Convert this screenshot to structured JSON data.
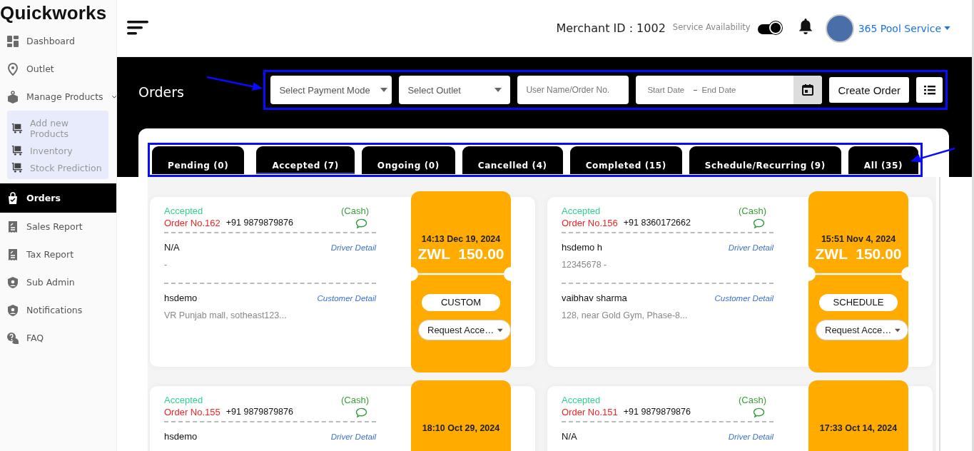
{
  "sidebar": {
    "logo": "Quickworks",
    "items": [
      {
        "label": "Dashboard",
        "selected": false
      },
      {
        "label": "Outlet",
        "selected": false
      },
      {
        "label": "Manage Products",
        "selected": false,
        "expanded": true,
        "children": [
          {
            "label": "Add new Products"
          },
          {
            "label": "Inventory"
          },
          {
            "label": "Stock Prediction"
          }
        ]
      },
      {
        "label": "Orders",
        "selected": true
      },
      {
        "label": "Sales Report",
        "selected": false
      },
      {
        "label": "Tax Report",
        "selected": false
      },
      {
        "label": "Sub Admin",
        "selected": false
      },
      {
        "label": "Notifications",
        "selected": false
      },
      {
        "label": "FAQ",
        "selected": false
      }
    ]
  },
  "header": {
    "merchant": "Merchant ID : 1002",
    "service_label": "Service Availability",
    "service_toggle": {
      "on": true
    },
    "account": "365 Pool Service"
  },
  "page_title": "Orders",
  "filters": {
    "payment_mode": {
      "placeholder": "Select Payment Mode"
    },
    "outlet": {
      "placeholder": "Select Outlet"
    },
    "search": {
      "placeholder": "User Name/Order No."
    },
    "start_date": {
      "placeholder": "Start Date"
    },
    "date_separator": "–",
    "end_date": {
      "placeholder": "End Date"
    },
    "create_button": "Create Order"
  },
  "tabs": [
    {
      "label": "Pending (0)",
      "selected": false
    },
    {
      "label": "Accepted (7)",
      "selected": true
    },
    {
      "label": "Ongoing (0)",
      "selected": false
    },
    {
      "label": "Cancelled (4)",
      "selected": false
    },
    {
      "label": "Completed (15)",
      "selected": false
    },
    {
      "label": "Schedule/Recurring (9)",
      "selected": false
    },
    {
      "label": "All (35)",
      "selected": false
    }
  ],
  "orders": [
    {
      "status": "Accepted",
      "order_no": "Order No.162",
      "phone": "+91 9879879876",
      "payment": "(Cash)",
      "driver": "N/A",
      "driver_info": "-",
      "driver_link": "Driver Detail",
      "customer": "hsdemo",
      "customer_address": "VR Punjab mall, sotheast123...",
      "customer_link": "Customer Detail",
      "datetime": "14:13 Dec 19, 2024",
      "amount": "ZWL  150.00",
      "type": "CUSTOM",
      "action": "Request Acce…"
    },
    {
      "status": "Accepted",
      "order_no": "Order No.156",
      "phone": "+91 8360172662",
      "payment": "(Cash)",
      "driver": "hsdemo h",
      "driver_info": "12345678 -",
      "driver_link": "Driver Detail",
      "customer": "vaibhav sharma",
      "customer_address": "128, near Gold Gym, Phase-8...",
      "customer_link": "Customer Detail",
      "datetime": "15:51 Nov 4, 2024",
      "amount": "ZWL  150.00",
      "type": "SCHEDULE",
      "action": "Request Acce…"
    },
    {
      "status": "Accepted",
      "order_no": "Order No.155",
      "phone": "+91 9879879876",
      "payment": "(Cash)",
      "driver": "hsdemo",
      "driver_link": "Driver Detail",
      "datetime": "18:10 Oct 29, 2024"
    },
    {
      "status": "Accepted",
      "order_no": "Order No.151",
      "phone": "+91 9879879876",
      "payment": "(Cash)",
      "driver": "N/A",
      "driver_link": "Driver Detail",
      "datetime": "17:33 Oct 14, 2024"
    }
  ]
}
